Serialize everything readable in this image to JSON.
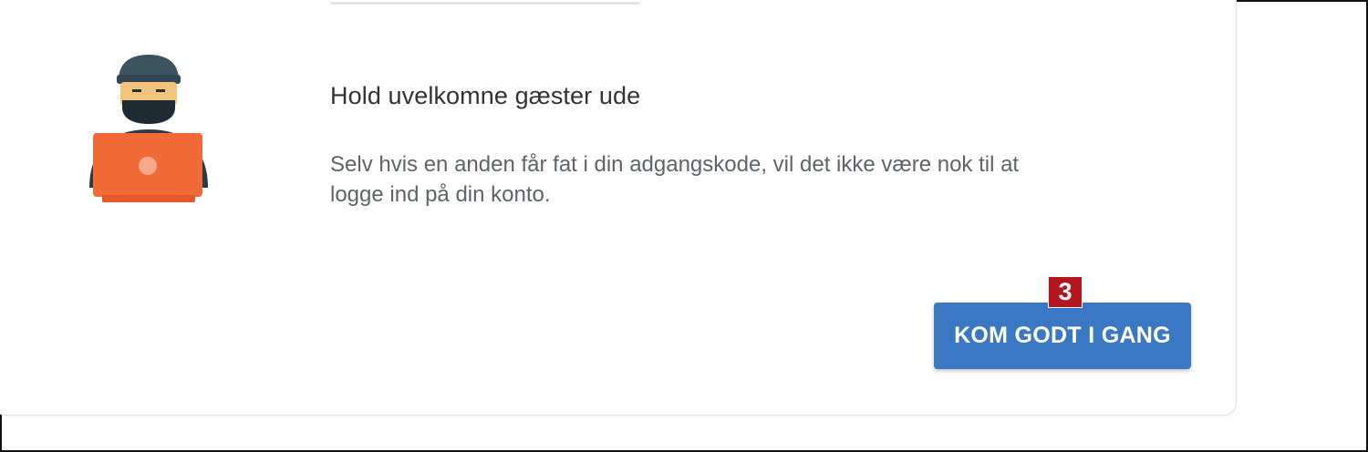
{
  "card": {
    "title": "Hold uvelkomne gæster ude",
    "description": "Selv hvis en anden får fat i din adgangskode, vil det ikke være nok til at logge ind på din konto.",
    "illustration_icon": "hacker-with-laptop-icon"
  },
  "cta": {
    "label": "KOM GODT I GANG",
    "color": "#3a78c3"
  },
  "step_badge": {
    "number": "3",
    "color": "#b3161e"
  }
}
